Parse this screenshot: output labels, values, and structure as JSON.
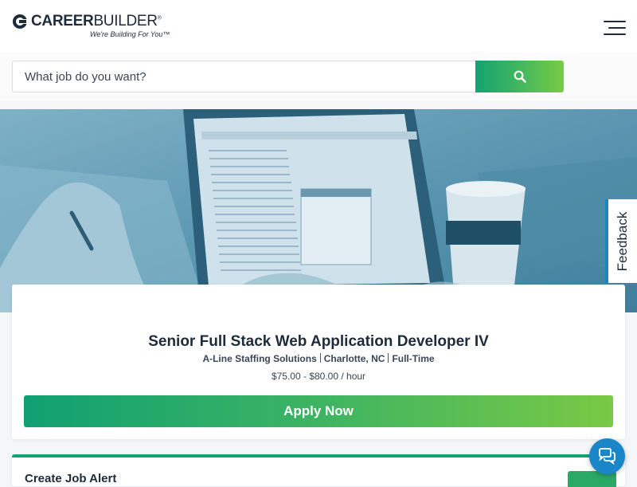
{
  "header": {
    "logo_bold": "CAREER",
    "logo_light": "BUILDER",
    "logo_mark": "®",
    "tagline": "We're Building For You™",
    "menu_icon": "hamburger-menu-icon"
  },
  "search": {
    "placeholder": "What job do you want?",
    "button_icon": "search-icon"
  },
  "feedback": {
    "label": "Feedback"
  },
  "job": {
    "title": "Senior Full Stack Web Application Developer IV",
    "company": "A-Line Staffing Solutions",
    "location": "Charlotte, NC",
    "type": "Full-Time",
    "pay": "$75.00 - $80.00 / hour",
    "apply_label": "Apply Now"
  },
  "alert": {
    "title": "Create Job Alert"
  },
  "chat": {
    "icon": "chat-bubbles-icon"
  },
  "colors": {
    "brand_navy": "#1d2b3a",
    "green_start": "#10a072",
    "green_end": "#79c944",
    "hero_tint": "#5f9ab3",
    "accent_blue": "#1a86c8"
  }
}
